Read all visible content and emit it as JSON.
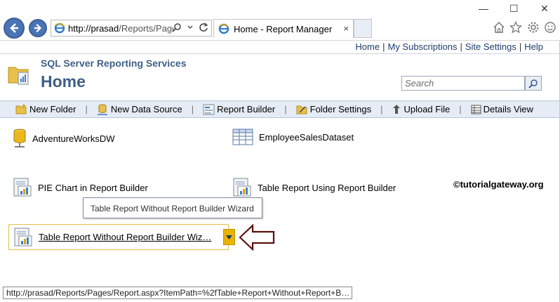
{
  "browser": {
    "address": {
      "host": "http://prasad",
      "path": "/Reports/Pages"
    },
    "tab": {
      "title": "Home - Report Manager",
      "close_glyph": "×"
    },
    "window_controls": {
      "minimize": "—",
      "maximize": "☐",
      "close": "✕"
    },
    "nav_colors": {
      "button": "#4a74b4"
    }
  },
  "header": {
    "links": [
      "Home",
      "My Subscriptions",
      "Site Settings",
      "Help"
    ],
    "service_name": "SQL Server Reporting Services",
    "page_title": "Home",
    "search": {
      "placeholder": "Search",
      "value": ""
    }
  },
  "toolbar": {
    "items": [
      {
        "label": "New Folder",
        "icon": "new-folder-icon"
      },
      {
        "label": "New Data Source",
        "icon": "new-data-source-icon"
      },
      {
        "label": "Report Builder",
        "icon": "report-builder-icon"
      },
      {
        "label": "Folder Settings",
        "icon": "folder-settings-icon"
      },
      {
        "label": "Upload File",
        "icon": "upload-file-icon"
      },
      {
        "label": "Details View",
        "icon": "details-view-icon"
      }
    ]
  },
  "items": [
    {
      "label": "AdventureWorksDW",
      "type": "data-source"
    },
    {
      "label": "EmployeeSalesDataset",
      "type": "dataset"
    },
    {
      "label": "PIE Chart in Report Builder",
      "type": "report"
    },
    {
      "label": "Table Report Using Report Builder",
      "type": "report"
    }
  ],
  "selected_item": {
    "label": "Table Report Without Report Builder Wiz…",
    "type": "report"
  },
  "tooltip": "Table Report Without Report Builder Wizard",
  "watermark": "©tutorialgateway.org",
  "status_url": "http://prasad/Reports/Pages/Report.aspx?ItemPath=%2fTable+Report+Without+Report+B…",
  "colors": {
    "title_text": "#3e5f86",
    "toolbar_bg": "#e6ecf5",
    "selection_border": "#e0c04a",
    "dropdown_button": "#e8b300"
  }
}
